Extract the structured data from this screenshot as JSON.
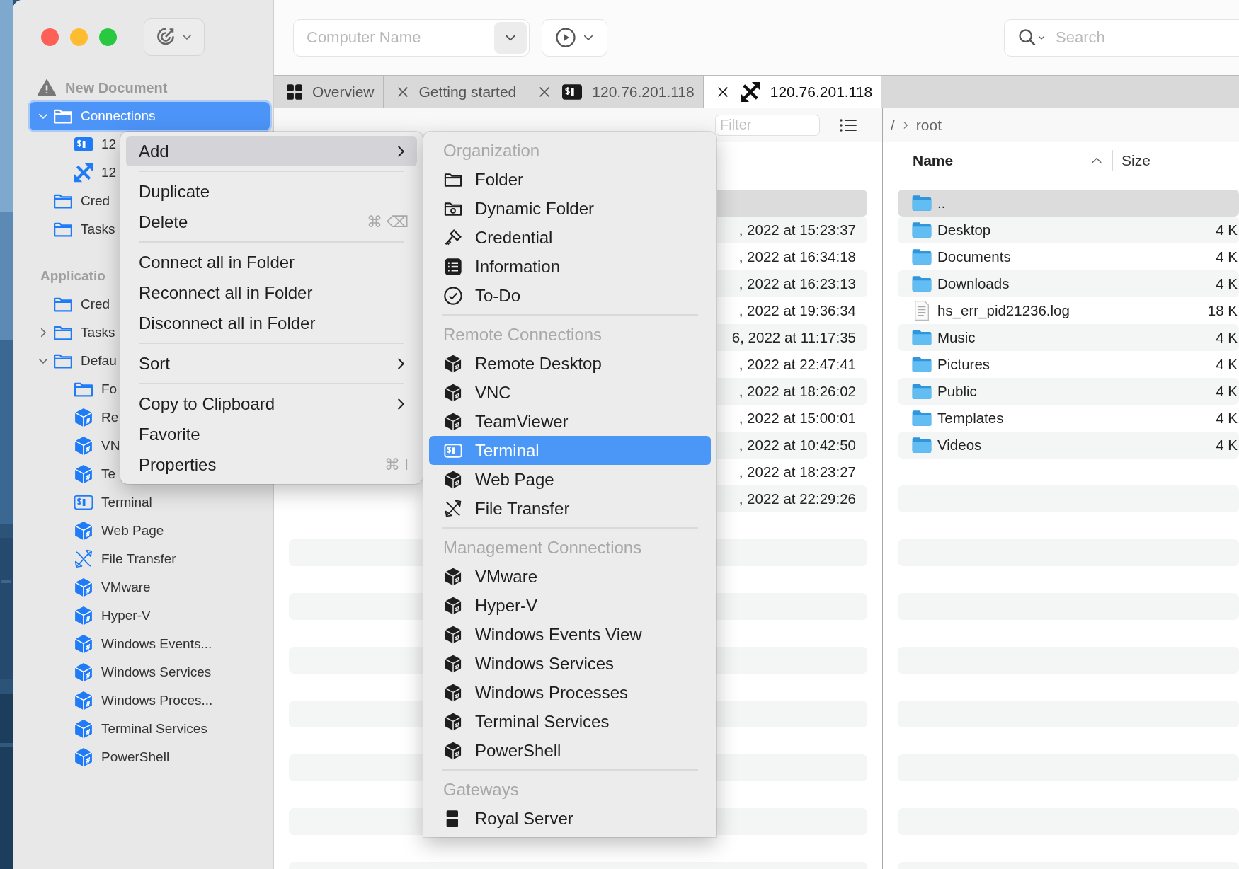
{
  "toolbar": {
    "computer_name": {
      "placeholder": "Computer Name"
    },
    "search": {
      "placeholder": "Search"
    }
  },
  "sidebar": {
    "document": {
      "label": "New Document"
    },
    "tree": [
      {
        "label": "Connections",
        "kind": "folder",
        "expanded": true,
        "selected": true,
        "children": [
          {
            "label": "12",
            "kind": "terminal",
            "selected": false
          },
          {
            "label": "12",
            "kind": "transfer",
            "selected": false
          }
        ]
      },
      {
        "label": "Cred",
        "kind": "folder",
        "selected": false
      },
      {
        "label": "Tasks",
        "kind": "folder",
        "selected": false
      }
    ],
    "sections": [
      {
        "label": "Applicatio",
        "items": [
          {
            "label": "Cred",
            "kind": "folder",
            "selected": false
          },
          {
            "label": "Tasks",
            "kind": "folder",
            "expanded": false,
            "selected": false
          },
          {
            "label": "Defau",
            "kind": "folder",
            "expanded": true,
            "selected": false,
            "children": [
              {
                "label": "Fo",
                "kind": "folder",
                "selected": false
              },
              {
                "label": "Re",
                "kind": "cube",
                "selected": false
              },
              {
                "label": "VN",
                "kind": "cube",
                "selected": false
              },
              {
                "label": "Te",
                "kind": "cube",
                "selected": false
              },
              {
                "label": "Terminal",
                "kind": "terminal-outline",
                "selected": false
              },
              {
                "label": "Web Page",
                "kind": "cube",
                "selected": false
              },
              {
                "label": "File Transfer",
                "kind": "transfer-outline",
                "selected": false
              },
              {
                "label": "VMware",
                "kind": "cube",
                "selected": false
              },
              {
                "label": "Hyper-V",
                "kind": "cube",
                "selected": false
              },
              {
                "label": "Windows Events...",
                "kind": "cube",
                "selected": false
              },
              {
                "label": "Windows Services",
                "kind": "cube",
                "selected": false
              },
              {
                "label": "Windows Proces...",
                "kind": "cube",
                "selected": false
              },
              {
                "label": "Terminal Services",
                "kind": "cube",
                "selected": false
              },
              {
                "label": "PowerShell",
                "kind": "cube",
                "selected": false
              }
            ]
          }
        ]
      }
    ]
  },
  "tabs": [
    {
      "label": "Overview",
      "kind": "overview",
      "closable": false,
      "selected": false
    },
    {
      "label": "Getting started",
      "kind": "page",
      "closable": true,
      "selected": false
    },
    {
      "label": "120.76.201.118",
      "kind": "terminal",
      "closable": true,
      "selected": false
    },
    {
      "label": "120.76.201.118",
      "kind": "transfer",
      "closable": true,
      "selected": true
    }
  ],
  "connection_list": {
    "filter": {
      "placeholder": "Filter"
    },
    "rows": [
      {
        "selected": true
      },
      {
        "column_2": ", 2022 at 15:23:37",
        "selected": false
      },
      {
        "column_2": ", 2022 at 16:34:18",
        "selected": false
      },
      {
        "column_2": ", 2022 at 16:23:13",
        "selected": false
      },
      {
        "column_2": ", 2022 at 19:36:34",
        "selected": false
      },
      {
        "column_2": "6, 2022 at 11:17:35",
        "selected": false
      },
      {
        "column_2": ", 2022 at 22:47:41",
        "selected": false
      },
      {
        "column_2": ", 2022 at 18:26:02",
        "selected": false
      },
      {
        "column_2": ", 2022 at 15:00:01",
        "selected": false
      },
      {
        "column_2": ", 2022 at 10:42:50",
        "selected": false
      },
      {
        "column_2": ", 2022 at 18:23:27",
        "selected": false
      },
      {
        "column_2": ", 2022 at 22:29:26",
        "selected": false
      }
    ]
  },
  "file_browser": {
    "path": [
      {
        "label": "/"
      },
      {
        "label": "root"
      }
    ],
    "columns": [
      {
        "label": "Name",
        "sort_ascending": true
      },
      {
        "label": "Size",
        "sort_ascending": false
      }
    ],
    "rows": [
      {
        "name": "..",
        "kind": "folder",
        "selected": true
      },
      {
        "name": "Desktop",
        "kind": "folder",
        "size": "4 K",
        "selected": false
      },
      {
        "name": "Documents",
        "kind": "folder",
        "size": "4 K",
        "selected": false
      },
      {
        "name": "Downloads",
        "kind": "folder",
        "size": "4 K",
        "selected": false
      },
      {
        "name": "hs_err_pid21236.log",
        "kind": "file",
        "size": "18 K",
        "selected": false
      },
      {
        "name": "Music",
        "kind": "folder",
        "size": "4 K",
        "selected": false
      },
      {
        "name": "Pictures",
        "kind": "folder",
        "size": "4 K",
        "selected": false
      },
      {
        "name": "Public",
        "kind": "folder",
        "size": "4 K",
        "selected": false
      },
      {
        "name": "Templates",
        "kind": "folder",
        "size": "4 K",
        "selected": false
      },
      {
        "name": "Videos",
        "kind": "folder",
        "size": "4 K",
        "selected": false
      }
    ]
  },
  "context_menu": {
    "items": [
      {
        "kind": "item",
        "label": "Add",
        "submenu": true,
        "selected": true
      },
      {
        "kind": "separator"
      },
      {
        "kind": "item",
        "label": "Duplicate",
        "selected": false
      },
      {
        "kind": "item",
        "label": "Delete",
        "shortcut": "⌘ ⌫",
        "selected": false
      },
      {
        "kind": "separator"
      },
      {
        "kind": "item",
        "label": "Connect all in Folder",
        "selected": false
      },
      {
        "kind": "item",
        "label": "Reconnect all in Folder",
        "selected": false
      },
      {
        "kind": "item",
        "label": "Disconnect all in Folder",
        "selected": false
      },
      {
        "kind": "separator"
      },
      {
        "kind": "item",
        "label": "Sort",
        "submenu": true,
        "selected": false
      },
      {
        "kind": "separator"
      },
      {
        "kind": "item",
        "label": "Copy to Clipboard",
        "submenu": true,
        "selected": false
      },
      {
        "kind": "item",
        "label": "Favorite",
        "selected": false
      },
      {
        "kind": "item",
        "label": "Properties",
        "shortcut": "⌘ I",
        "selected": false
      }
    ]
  },
  "submenu": {
    "items": [
      {
        "kind": "header",
        "label": "Organization"
      },
      {
        "kind": "folder",
        "label": "Folder",
        "selected": false
      },
      {
        "kind": "dynamic",
        "label": "Dynamic Folder",
        "selected": false
      },
      {
        "kind": "key",
        "label": "Credential",
        "selected": false
      },
      {
        "kind": "list",
        "label": "Information",
        "selected": false
      },
      {
        "kind": "check",
        "label": "To-Do",
        "selected": false
      },
      {
        "kind": "separator"
      },
      {
        "kind": "header",
        "label": "Remote Connections"
      },
      {
        "kind": "cube",
        "label": "Remote Desktop",
        "selected": false
      },
      {
        "kind": "cube",
        "label": "VNC",
        "selected": false
      },
      {
        "kind": "cube",
        "label": "TeamViewer",
        "selected": false
      },
      {
        "kind": "terminal-outline",
        "label": "Terminal",
        "selected": true
      },
      {
        "kind": "cube",
        "label": "Web Page",
        "selected": false
      },
      {
        "kind": "transfer-outline",
        "label": "File Transfer",
        "selected": false
      },
      {
        "kind": "separator"
      },
      {
        "kind": "header",
        "label": "Management Connections"
      },
      {
        "kind": "cube",
        "label": "VMware",
        "selected": false
      },
      {
        "kind": "cube",
        "label": "Hyper-V",
        "selected": false
      },
      {
        "kind": "cube",
        "label": "Windows Events View",
        "selected": false
      },
      {
        "kind": "cube",
        "label": "Windows Services",
        "selected": false
      },
      {
        "kind": "cube",
        "label": "Windows Processes",
        "selected": false
      },
      {
        "kind": "cube",
        "label": "Terminal Services",
        "selected": false
      },
      {
        "kind": "cube",
        "label": "PowerShell",
        "selected": false
      },
      {
        "kind": "separator"
      },
      {
        "kind": "header",
        "label": "Gateways"
      },
      {
        "kind": "server",
        "label": "Royal Server",
        "selected": false
      }
    ]
  }
}
